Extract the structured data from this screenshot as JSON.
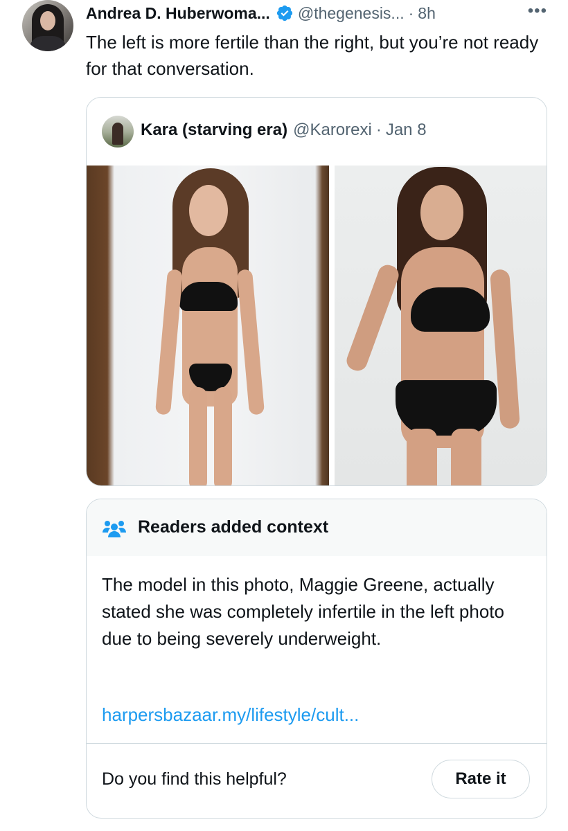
{
  "tweet": {
    "author_name": "Andrea D. Huberwoma...",
    "handle": "@thegenesis...",
    "separator": "·",
    "time": "8h",
    "more_label": "•••",
    "text": "The left is more fertile than the right, but you’re not ready for that conversation."
  },
  "quote": {
    "author_name": "Kara (starving era)",
    "handle": "@Karorexi",
    "separator": "·",
    "date": "Jan 8"
  },
  "context": {
    "title": "Readers added context",
    "body": "The model in this photo, Maggie Greene, actually stated she was completely infertile in the left photo due to being severely underweight.",
    "link": "harpersbazaar.my/lifestyle/cult...",
    "helpful_question": "Do you find this helpful?",
    "rate_label": "Rate it"
  },
  "colors": {
    "text": "#0f1419",
    "secondary": "#536471",
    "link": "#1d9bf0",
    "border": "#cfd9de",
    "verified": "#1d9bf0"
  }
}
